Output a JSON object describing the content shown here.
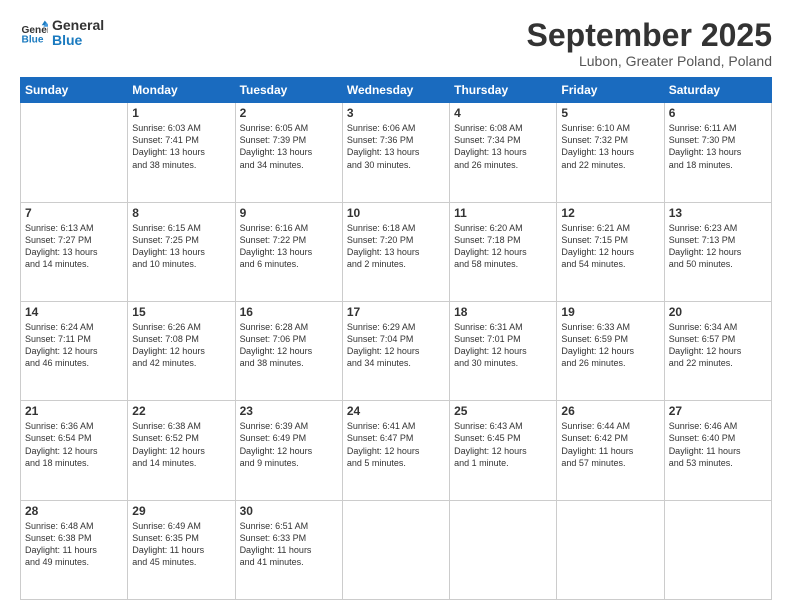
{
  "logo": {
    "line1": "General",
    "line2": "Blue"
  },
  "title": "September 2025",
  "location": "Lubon, Greater Poland, Poland",
  "weekdays": [
    "Sunday",
    "Monday",
    "Tuesday",
    "Wednesday",
    "Thursday",
    "Friday",
    "Saturday"
  ],
  "weeks": [
    [
      {
        "day": "",
        "info": ""
      },
      {
        "day": "1",
        "info": "Sunrise: 6:03 AM\nSunset: 7:41 PM\nDaylight: 13 hours\nand 38 minutes."
      },
      {
        "day": "2",
        "info": "Sunrise: 6:05 AM\nSunset: 7:39 PM\nDaylight: 13 hours\nand 34 minutes."
      },
      {
        "day": "3",
        "info": "Sunrise: 6:06 AM\nSunset: 7:36 PM\nDaylight: 13 hours\nand 30 minutes."
      },
      {
        "day": "4",
        "info": "Sunrise: 6:08 AM\nSunset: 7:34 PM\nDaylight: 13 hours\nand 26 minutes."
      },
      {
        "day": "5",
        "info": "Sunrise: 6:10 AM\nSunset: 7:32 PM\nDaylight: 13 hours\nand 22 minutes."
      },
      {
        "day": "6",
        "info": "Sunrise: 6:11 AM\nSunset: 7:30 PM\nDaylight: 13 hours\nand 18 minutes."
      }
    ],
    [
      {
        "day": "7",
        "info": "Sunrise: 6:13 AM\nSunset: 7:27 PM\nDaylight: 13 hours\nand 14 minutes."
      },
      {
        "day": "8",
        "info": "Sunrise: 6:15 AM\nSunset: 7:25 PM\nDaylight: 13 hours\nand 10 minutes."
      },
      {
        "day": "9",
        "info": "Sunrise: 6:16 AM\nSunset: 7:22 PM\nDaylight: 13 hours\nand 6 minutes."
      },
      {
        "day": "10",
        "info": "Sunrise: 6:18 AM\nSunset: 7:20 PM\nDaylight: 13 hours\nand 2 minutes."
      },
      {
        "day": "11",
        "info": "Sunrise: 6:20 AM\nSunset: 7:18 PM\nDaylight: 12 hours\nand 58 minutes."
      },
      {
        "day": "12",
        "info": "Sunrise: 6:21 AM\nSunset: 7:15 PM\nDaylight: 12 hours\nand 54 minutes."
      },
      {
        "day": "13",
        "info": "Sunrise: 6:23 AM\nSunset: 7:13 PM\nDaylight: 12 hours\nand 50 minutes."
      }
    ],
    [
      {
        "day": "14",
        "info": "Sunrise: 6:24 AM\nSunset: 7:11 PM\nDaylight: 12 hours\nand 46 minutes."
      },
      {
        "day": "15",
        "info": "Sunrise: 6:26 AM\nSunset: 7:08 PM\nDaylight: 12 hours\nand 42 minutes."
      },
      {
        "day": "16",
        "info": "Sunrise: 6:28 AM\nSunset: 7:06 PM\nDaylight: 12 hours\nand 38 minutes."
      },
      {
        "day": "17",
        "info": "Sunrise: 6:29 AM\nSunset: 7:04 PM\nDaylight: 12 hours\nand 34 minutes."
      },
      {
        "day": "18",
        "info": "Sunrise: 6:31 AM\nSunset: 7:01 PM\nDaylight: 12 hours\nand 30 minutes."
      },
      {
        "day": "19",
        "info": "Sunrise: 6:33 AM\nSunset: 6:59 PM\nDaylight: 12 hours\nand 26 minutes."
      },
      {
        "day": "20",
        "info": "Sunrise: 6:34 AM\nSunset: 6:57 PM\nDaylight: 12 hours\nand 22 minutes."
      }
    ],
    [
      {
        "day": "21",
        "info": "Sunrise: 6:36 AM\nSunset: 6:54 PM\nDaylight: 12 hours\nand 18 minutes."
      },
      {
        "day": "22",
        "info": "Sunrise: 6:38 AM\nSunset: 6:52 PM\nDaylight: 12 hours\nand 14 minutes."
      },
      {
        "day": "23",
        "info": "Sunrise: 6:39 AM\nSunset: 6:49 PM\nDaylight: 12 hours\nand 9 minutes."
      },
      {
        "day": "24",
        "info": "Sunrise: 6:41 AM\nSunset: 6:47 PM\nDaylight: 12 hours\nand 5 minutes."
      },
      {
        "day": "25",
        "info": "Sunrise: 6:43 AM\nSunset: 6:45 PM\nDaylight: 12 hours\nand 1 minute."
      },
      {
        "day": "26",
        "info": "Sunrise: 6:44 AM\nSunset: 6:42 PM\nDaylight: 11 hours\nand 57 minutes."
      },
      {
        "day": "27",
        "info": "Sunrise: 6:46 AM\nSunset: 6:40 PM\nDaylight: 11 hours\nand 53 minutes."
      }
    ],
    [
      {
        "day": "28",
        "info": "Sunrise: 6:48 AM\nSunset: 6:38 PM\nDaylight: 11 hours\nand 49 minutes."
      },
      {
        "day": "29",
        "info": "Sunrise: 6:49 AM\nSunset: 6:35 PM\nDaylight: 11 hours\nand 45 minutes."
      },
      {
        "day": "30",
        "info": "Sunrise: 6:51 AM\nSunset: 6:33 PM\nDaylight: 11 hours\nand 41 minutes."
      },
      {
        "day": "",
        "info": ""
      },
      {
        "day": "",
        "info": ""
      },
      {
        "day": "",
        "info": ""
      },
      {
        "day": "",
        "info": ""
      }
    ]
  ]
}
